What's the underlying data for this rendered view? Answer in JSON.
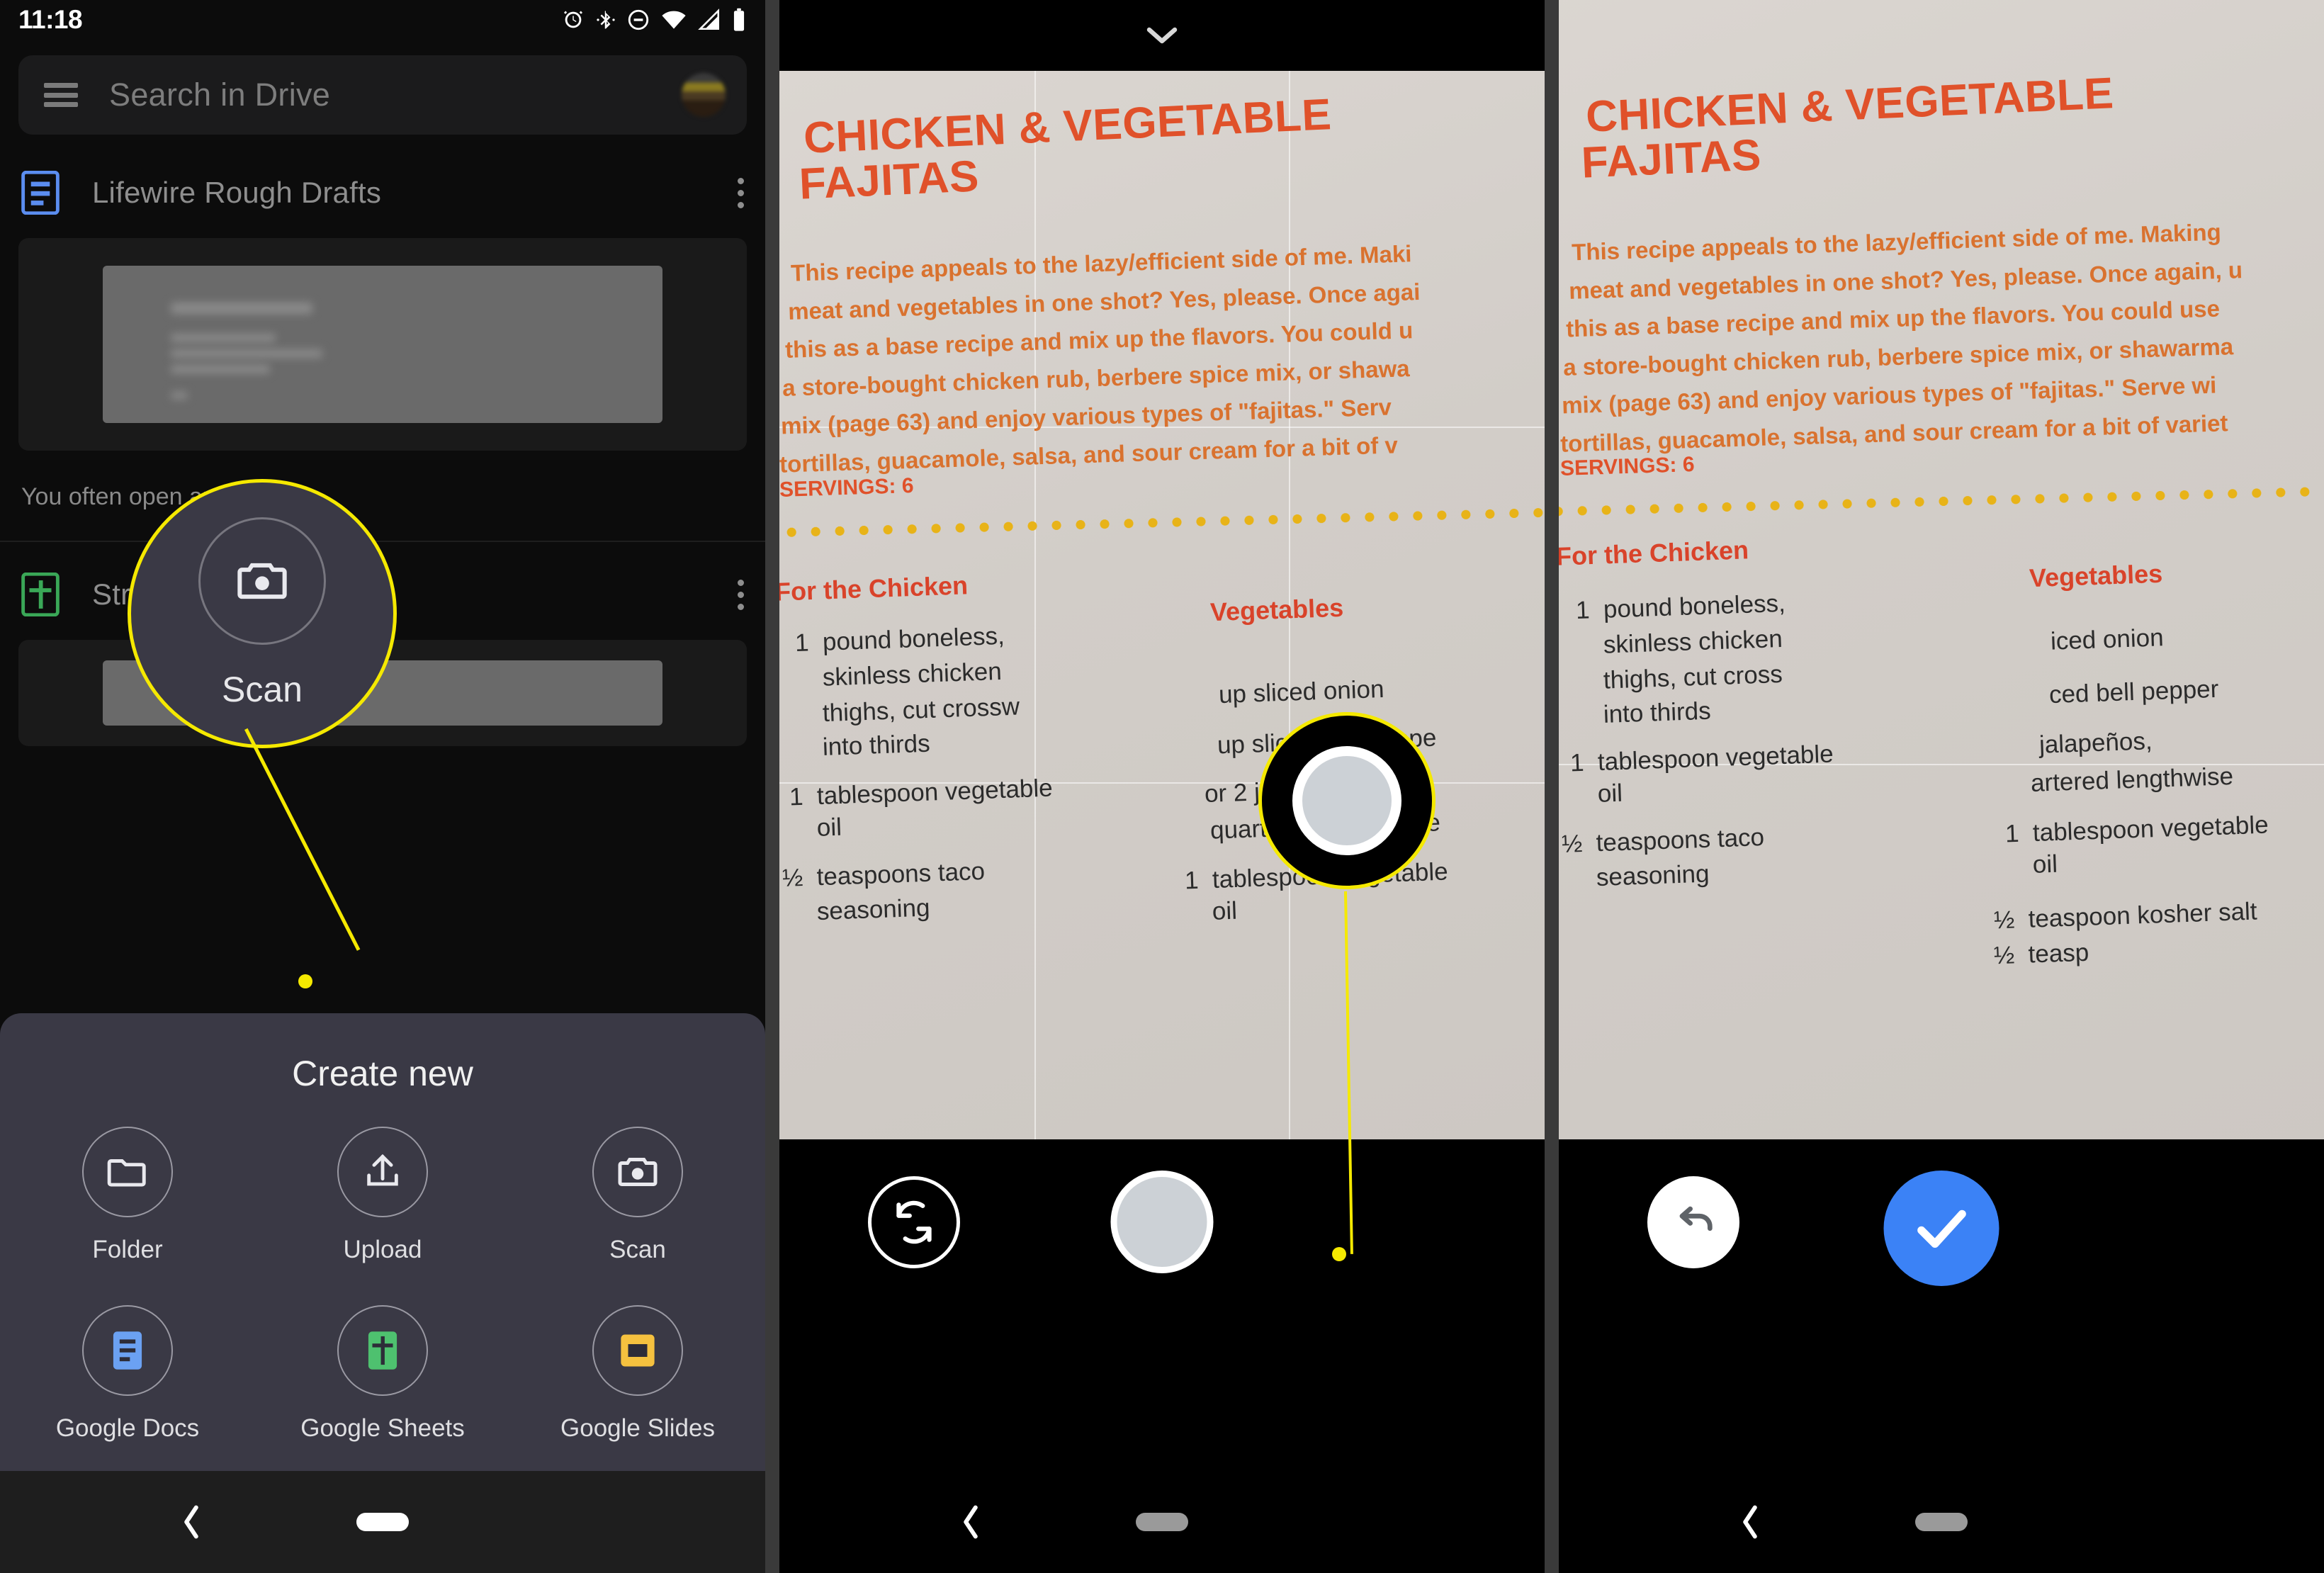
{
  "panel1": {
    "status": {
      "time": "11:18",
      "icons": [
        "alarm-icon",
        "bluetooth-icon",
        "do-not-disturb-icon",
        "wifi-icon",
        "cell-signal-icon",
        "battery-icon"
      ]
    },
    "search": {
      "placeholder": "Search in Drive",
      "menu_icon": "hamburger-menu-icon",
      "avatar": "user-avatar"
    },
    "rows": [
      {
        "label": "Lifewire Rough Drafts",
        "icon": "google-docs-icon",
        "overflow": "more-options-icon"
      },
      {
        "label": "Streaming",
        "icon": "google-sheets-icon",
        "overflow": "more-options-icon"
      }
    ],
    "hint": "You often open arou",
    "sheet": {
      "title": "Create new",
      "items": [
        {
          "label": "Folder",
          "icon": "folder-icon"
        },
        {
          "label": "Upload",
          "icon": "upload-icon"
        },
        {
          "label": "Scan",
          "icon": "camera-scan-icon"
        },
        {
          "label": "Google Docs",
          "icon": "google-docs-icon"
        },
        {
          "label": "Google Sheets",
          "icon": "google-sheets-icon"
        },
        {
          "label": "Google Slides",
          "icon": "google-slides-icon"
        }
      ]
    },
    "callout": {
      "label": "Scan",
      "icon": "camera-scan-icon"
    },
    "nav": {
      "back": "back-icon",
      "home": "home-pill"
    }
  },
  "panel2": {
    "collapse_icon": "chevron-down-icon",
    "doc": {
      "title_line1": "CHICKEN & VEGETABLE",
      "title_line2": "FAJITAS",
      "body": [
        "This recipe appeals to the lazy/efficient side of me. Maki",
        "meat and vegetables in one shot? Yes, please. Once agai",
        "this as a base recipe and mix up the flavors. You could u",
        "a store-bought chicken rub, berbere spice mix, or shawa",
        "mix (page 63) and enjoy various types of \"fajitas.\" Serv",
        "tortillas, guacamole, salsa, and sour cream for a bit of v"
      ],
      "servings": "SERVINGS: 6",
      "section_left": "For the Chicken",
      "section_right": "Vegetables",
      "left_items": [
        "1  pound boneless,",
        "    skinless chicken",
        "    thighs, cut crossw",
        "    into thirds",
        "1  tablespoon vegetable",
        "    oil",
        "½  teaspoons taco",
        "    seasoning"
      ],
      "right_items": [
        "up sliced onion",
        "up sliced bell peppe",
        "or 2 jalapeños,",
        "quartered lengthwise",
        "1  tablespoon vegetable",
        "    oil"
      ]
    },
    "callout": {
      "icon": "shutter-button"
    },
    "controls": {
      "flip": "flip-camera-icon",
      "shutter": "shutter-button"
    },
    "nav": {
      "back": "back-icon",
      "home": "home-pill"
    }
  },
  "panel3": {
    "doc": {
      "title_line1": "CHICKEN & VEGETABLE",
      "title_line2": "FAJITAS",
      "body": [
        "This recipe appeals to the lazy/efficient side of me. Making",
        "meat and vegetables in one shot? Yes, please. Once again, u",
        "this as a base recipe and mix up the flavors. You could use",
        "a store-bought chicken rub, berbere spice mix, or shawarma",
        "mix (page 63) and enjoy various types of \"fajitas.\" Serve wi",
        "tortillas, guacamole, salsa, and sour cream for a bit of variet"
      ],
      "servings": "SERVINGS: 6",
      "section_left": "For the Chicken",
      "section_right": "Vegetables",
      "left_items": [
        "1  pound boneless,",
        "    skinless chicken",
        "    thighs, cut cross",
        "    into thirds",
        "1  tablespoon vegetable",
        "    oil",
        "½  teaspoons taco",
        "    seasoning"
      ],
      "right_items": [
        "iced onion",
        "ced bell pepper",
        "jalapeños,",
        "artered lengthwise",
        "1  tablespoon vegetable",
        "    oil",
        "½  teaspoon kosher salt",
        "½  teasp"
      ]
    },
    "callout": {
      "icon": "check-mark-icon"
    },
    "controls": {
      "undo": "undo-icon",
      "done": "check-mark-icon"
    },
    "nav": {
      "back": "back-icon",
      "home": "home-pill"
    }
  },
  "colors": {
    "highlight": "#f5e900",
    "accent_blue": "#3b82f6",
    "recipe_title_red": "#e0512a",
    "recipe_body_orange": "#d9722f",
    "sheet_bg": "#3a3945"
  }
}
